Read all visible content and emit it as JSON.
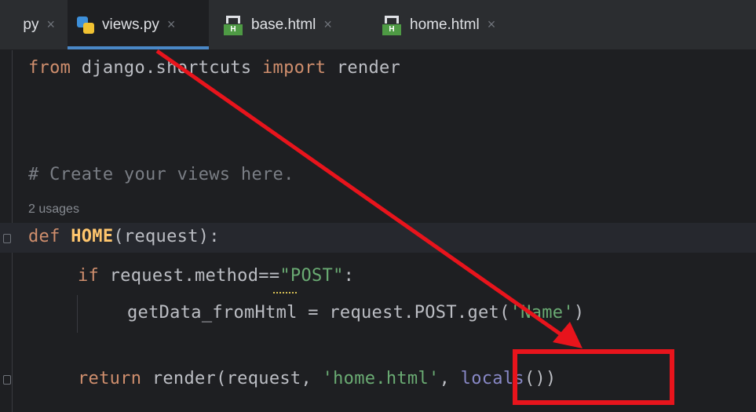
{
  "tabs": [
    {
      "label": "py",
      "active": false
    },
    {
      "label": "views.py",
      "active": true
    },
    {
      "label": "base.html",
      "active": false
    },
    {
      "label": "home.html",
      "active": false
    }
  ],
  "close_glyph": "×",
  "code": {
    "line1": {
      "kw": "from",
      "mod": " django.shortcuts ",
      "kw2": "import",
      "name": " render"
    },
    "comment": "# Create your views here.",
    "usages": "2 usages",
    "def_line": {
      "kw": "def",
      "name": "HOME",
      "rest": "(request):"
    },
    "if_line": {
      "kw": "if",
      "rest": " request.method",
      "op": "==",
      "str": "\"POST\"",
      "colon": ":"
    },
    "assign_line": {
      "lhs": "getData_fromHtml = request.POST.get(",
      "str": "'Name'",
      "end": ")"
    },
    "return_line": {
      "kw": "return",
      "mid": " render(request, ",
      "str": "'home.html'",
      "comma": ", ",
      "builtin": "locals",
      "end": "())"
    }
  },
  "colors": {
    "annotation": "#e8141c",
    "keyword": "#cf8e6d",
    "string": "#6aab73",
    "function_name": "#ffc66d"
  },
  "icons": {
    "python_file": "python-file-icon",
    "html_file": "html-file-icon"
  }
}
